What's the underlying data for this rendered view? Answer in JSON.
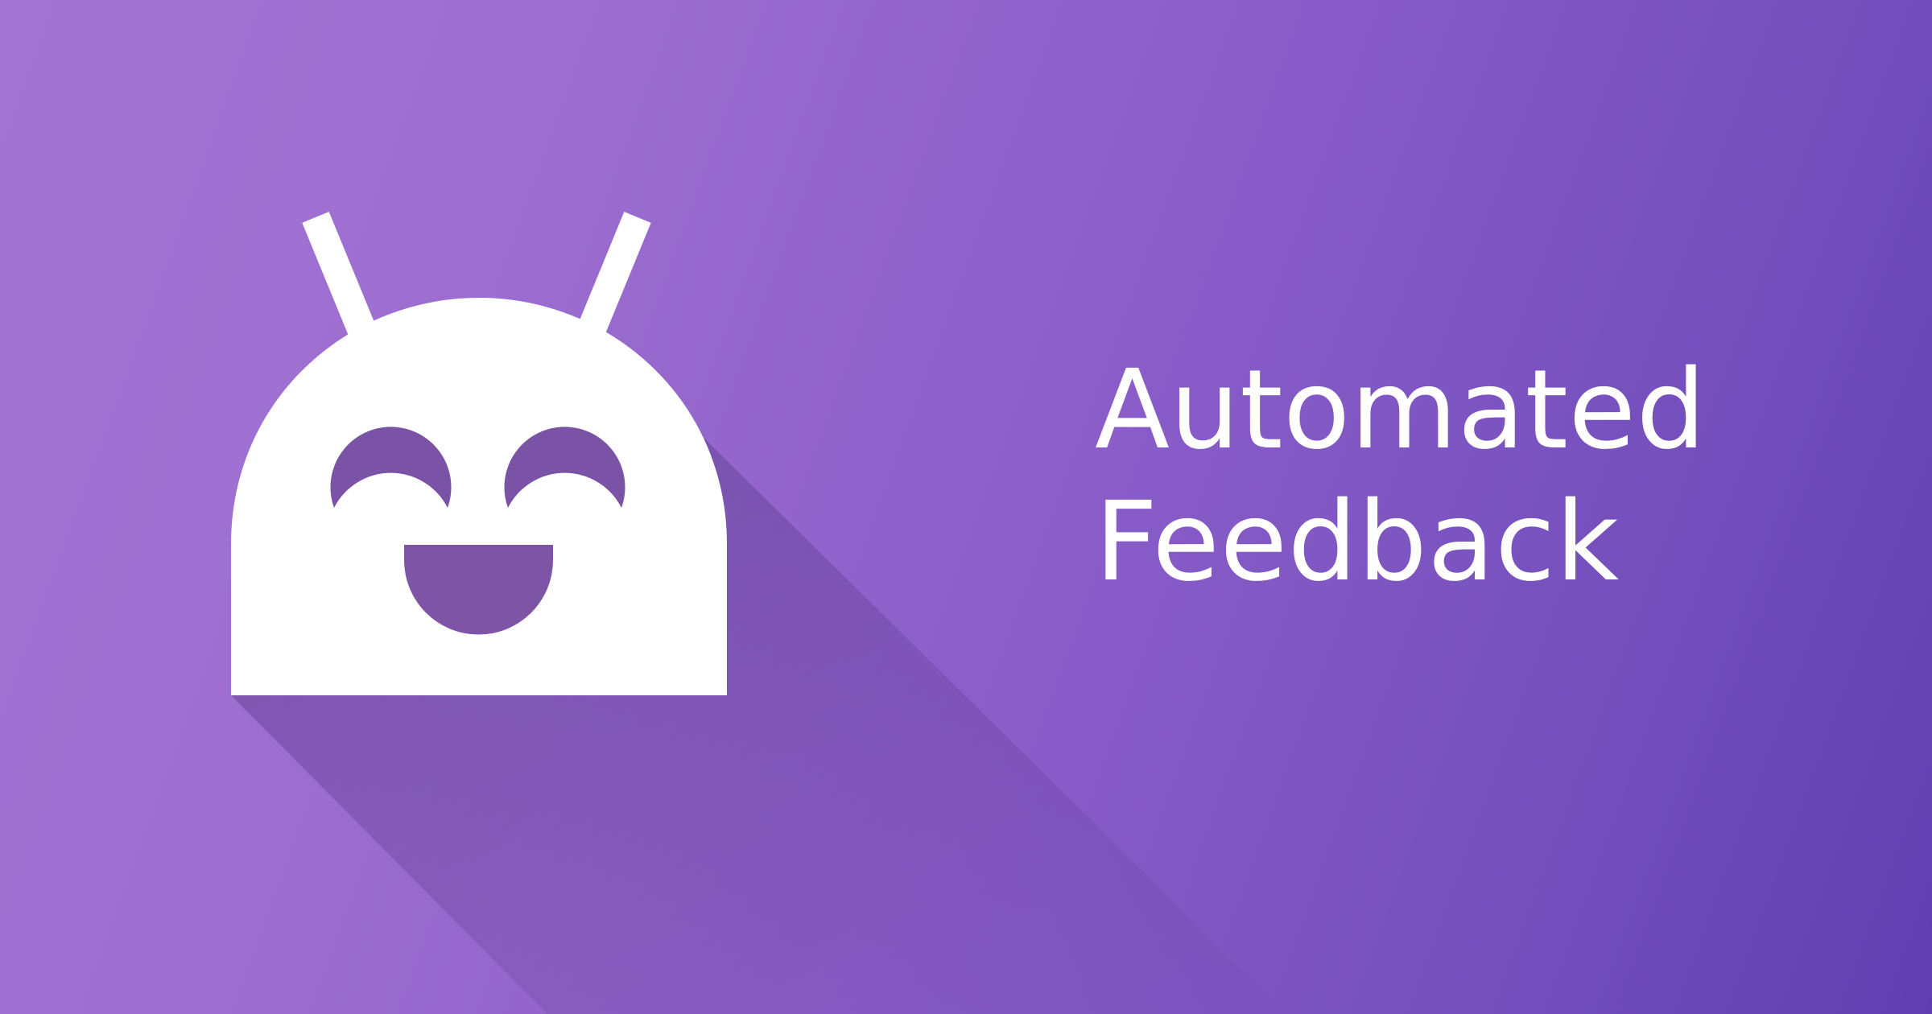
{
  "banner": {
    "title_line_1": "Automated",
    "title_line_2": "Feedback"
  },
  "colors": {
    "gradient_start": "#a474d3",
    "gradient_end": "#5f3fb0",
    "mascot": "#ffffff",
    "face_features": "#7a52a6",
    "long_shadow": "#5a3a8a",
    "title_text": "#ffffff"
  },
  "icons": {
    "mascot": "happy-android-robot-icon"
  }
}
